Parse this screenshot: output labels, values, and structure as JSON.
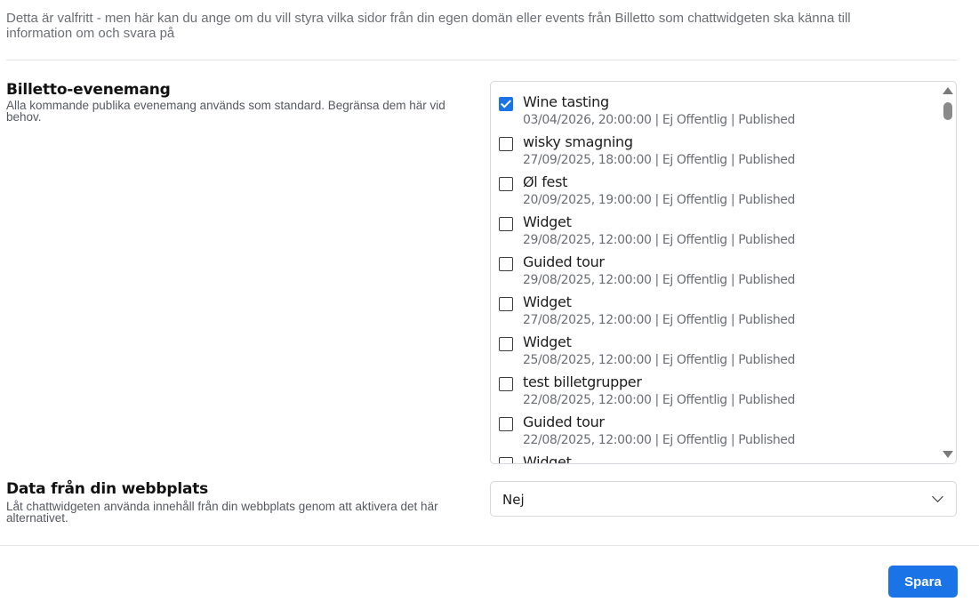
{
  "intro_text": "Detta är valfritt - men här kan du ange om du vill styra vilka sidor från din egen domän eller events från Billetto som chattwidgeten ska känna till information om och svara på",
  "events_section": {
    "title": "Billetto-evenemang",
    "description": "Alla kommande publika evenemang används som standard. Begränsa dem här vid behov.",
    "events": [
      {
        "name": "Wine tasting",
        "meta": "03/04/2026, 20:00:00 | Ej Offentlig | Published",
        "checked": true
      },
      {
        "name": "wisky smagning",
        "meta": "27/09/2025, 18:00:00 | Ej Offentlig | Published",
        "checked": false
      },
      {
        "name": "Øl fest",
        "meta": "20/09/2025, 19:00:00 | Ej Offentlig | Published",
        "checked": false
      },
      {
        "name": "Widget",
        "meta": "29/08/2025, 12:00:00 | Ej Offentlig | Published",
        "checked": false
      },
      {
        "name": "Guided tour",
        "meta": "29/08/2025, 12:00:00 | Ej Offentlig | Published",
        "checked": false
      },
      {
        "name": "Widget",
        "meta": "27/08/2025, 12:00:00 | Ej Offentlig | Published",
        "checked": false
      },
      {
        "name": "Widget",
        "meta": "25/08/2025, 12:00:00 | Ej Offentlig | Published",
        "checked": false
      },
      {
        "name": "test billetgrupper",
        "meta": "22/08/2025, 12:00:00 | Ej Offentlig | Published",
        "checked": false
      },
      {
        "name": "Guided tour",
        "meta": "22/08/2025, 12:00:00 | Ej Offentlig | Published",
        "checked": false
      },
      {
        "name": "Widget",
        "meta": "",
        "checked": false
      }
    ]
  },
  "website_section": {
    "title": "Data från din webbplats",
    "description": "Låt chattwidgeten använda innehåll från din webbplats genom att aktivera det här alternativet.",
    "selected_value": "Nej"
  },
  "save_label": "Spara",
  "colors": {
    "accent": "#1b73e8"
  }
}
